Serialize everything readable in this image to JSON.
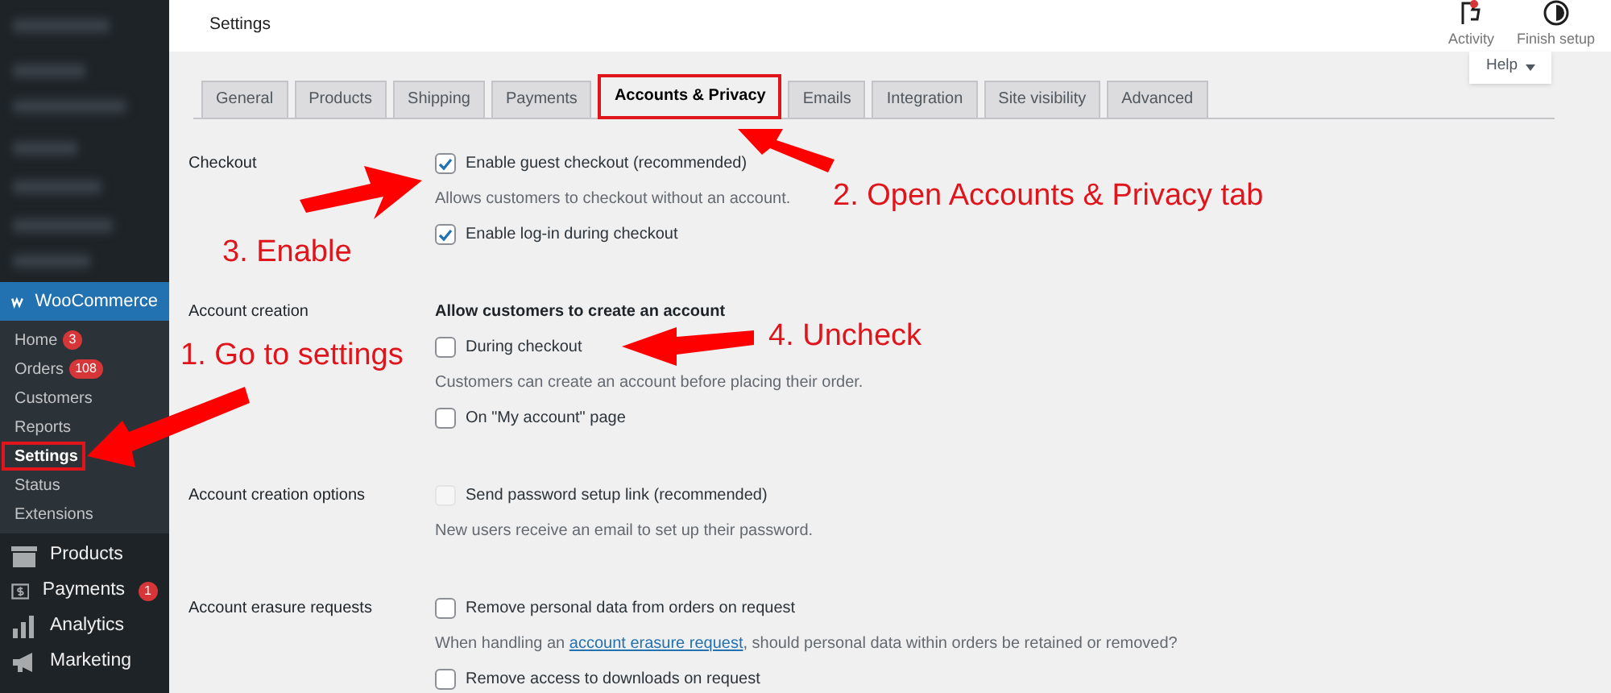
{
  "header": {
    "title": "Settings",
    "actions": [
      {
        "kind": "activity",
        "label": "Activity",
        "alert": true
      },
      {
        "kind": "setup",
        "label": "Finish setup",
        "alert": false
      }
    ],
    "help": "Help"
  },
  "sidebar": {
    "plugin": "WooCommerce",
    "submenu": [
      {
        "label": "Home",
        "badge": "3",
        "selected": false,
        "highlighted": false
      },
      {
        "label": "Orders",
        "badge": "108",
        "selected": false,
        "highlighted": false
      },
      {
        "label": "Customers",
        "selected": false,
        "highlighted": false
      },
      {
        "label": "Reports",
        "selected": false,
        "highlighted": false
      },
      {
        "label": "Settings",
        "selected": true,
        "highlighted": true
      },
      {
        "label": "Status",
        "selected": false,
        "highlighted": false
      },
      {
        "label": "Extensions",
        "selected": false,
        "highlighted": false
      }
    ],
    "menu": [
      {
        "kind": "products",
        "label": "Products"
      },
      {
        "kind": "payments",
        "label": "Payments",
        "badge": "1"
      },
      {
        "kind": "analytics",
        "label": "Analytics"
      },
      {
        "kind": "marketing",
        "label": "Marketing"
      }
    ]
  },
  "tabs": [
    {
      "label": "General",
      "selected": false,
      "highlighted": false
    },
    {
      "label": "Products",
      "selected": false,
      "highlighted": false
    },
    {
      "label": "Shipping",
      "selected": false,
      "highlighted": false
    },
    {
      "label": "Payments",
      "selected": false,
      "highlighted": false
    },
    {
      "label": "Accounts & Privacy",
      "selected": true,
      "highlighted": true
    },
    {
      "label": "Emails",
      "selected": false,
      "highlighted": false
    },
    {
      "label": "Integration",
      "selected": false,
      "highlighted": false
    },
    {
      "label": "Site visibility",
      "selected": false,
      "highlighted": false
    },
    {
      "label": "Advanced",
      "selected": false,
      "highlighted": false
    }
  ],
  "sections": [
    {
      "label": "Checkout",
      "items": [
        {
          "kind": "checkbox",
          "label": "Enable guest checkout (recommended)",
          "checked": true,
          "disabled": false
        },
        {
          "kind": "description",
          "text": "Allows customers to checkout without an account."
        },
        {
          "kind": "checkbox",
          "label": "Enable log-in during checkout",
          "checked": true,
          "disabled": false
        }
      ]
    },
    {
      "label": "Account creation",
      "items": [
        {
          "kind": "heading",
          "text": "Allow customers to create an account"
        },
        {
          "kind": "checkbox",
          "label": "During checkout",
          "checked": false,
          "disabled": false
        },
        {
          "kind": "description",
          "text": "Customers can create an account before placing their order."
        },
        {
          "kind": "checkbox",
          "label": "On \"My account\" page",
          "checked": false,
          "disabled": false
        }
      ]
    },
    {
      "label": "Account creation options",
      "items": [
        {
          "kind": "checkbox",
          "label": "Send password setup link (recommended)",
          "checked": false,
          "disabled": true
        },
        {
          "kind": "description",
          "text": "New users receive an email to set up their password."
        }
      ]
    },
    {
      "label": "Account erasure requests",
      "items": [
        {
          "kind": "checkbox",
          "label": "Remove personal data from orders on request",
          "checked": false,
          "disabled": false
        },
        {
          "kind": "description",
          "text": "When handling an",
          "link": "account erasure request",
          "after": ", should personal data within orders be retained or removed?"
        },
        {
          "kind": "checkbox",
          "label": "Remove access to downloads on request",
          "checked": false,
          "disabled": false
        }
      ]
    }
  ],
  "annotations": [
    "1. Go to settings",
    "2. Open Accounts & Privacy tab",
    "3. Enable",
    "4. Uncheck"
  ]
}
